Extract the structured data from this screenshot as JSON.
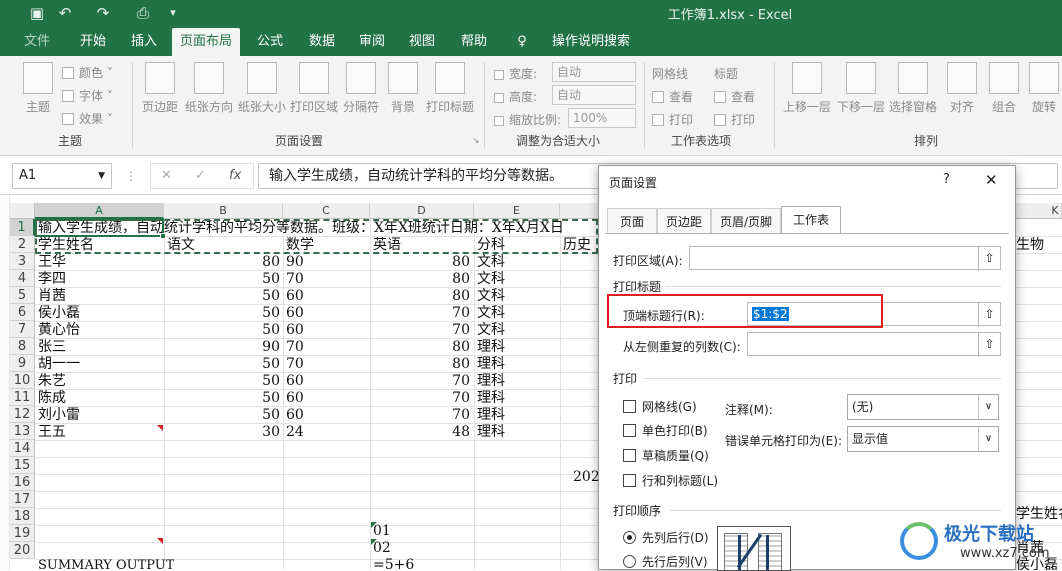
{
  "app": {
    "title": "工作簿1.xlsx  -  Excel"
  },
  "menu_tabs": [
    "文件",
    "开始",
    "插入",
    "页面布局",
    "公式",
    "数据",
    "审阅",
    "视图",
    "帮助",
    "操作说明搜索"
  ],
  "ribbon": {
    "theme_group": {
      "label": "主题",
      "themes": "主题",
      "colors": "颜色",
      "fonts": "字体",
      "effects": "效果"
    },
    "page_setup_group": {
      "label": "页面设置",
      "margins": "页边距",
      "orientation": "纸张方向",
      "size": "纸张大小",
      "print_area": "打印区域",
      "breaks": "分隔符",
      "background": "背景",
      "print_titles": "打印标题"
    },
    "scale_group": {
      "label": "调整为合适大小",
      "width_label": "宽度:",
      "width_value": "自动",
      "height_label": "高度:",
      "height_value": "自动",
      "scale_label": "缩放比例:",
      "scale_value": "100%"
    },
    "sheet_options_group": {
      "label": "工作表选项",
      "gridlines": "网格线",
      "headings": "标题",
      "view": "查看",
      "print": "打印"
    },
    "arrange_group": {
      "label": "排列",
      "bring_forward": "上移一层",
      "send_backward": "下移一层",
      "selection_pane": "选择窗格",
      "align": "对齐",
      "group": "组合",
      "rotate": "旋转"
    }
  },
  "formula_bar": {
    "name_box": "A1",
    "fx": "fx",
    "content": "输入学生成绩，自动统计学科的平均分等数据。"
  },
  "grid": {
    "columns": [
      "A",
      "B",
      "C",
      "D",
      "E",
      "K"
    ],
    "rows": [
      "1",
      "2",
      "3",
      "4",
      "5",
      "6",
      "7",
      "8",
      "9",
      "10",
      "11",
      "12",
      "13",
      "14",
      "15",
      "16",
      "17",
      "18",
      "19",
      "20"
    ],
    "row1": "输入学生成绩，自动统计学科的平均分等数据。班级：X年X班统计日期：X年X月X日",
    "headers": [
      "学生姓名",
      "语文",
      "数学",
      "英语",
      "分科",
      "历史"
    ],
    "students": [
      {
        "name": "王华",
        "chinese": "80",
        "math": "90",
        "english": "80",
        "track": "文科"
      },
      {
        "name": "李四",
        "chinese": "50",
        "math": "70",
        "english": "80",
        "track": "文科"
      },
      {
        "name": "肖茜",
        "chinese": "50",
        "math": "60",
        "english": "80",
        "track": "文科"
      },
      {
        "name": "侯小磊",
        "chinese": "50",
        "math": "60",
        "english": "70",
        "track": "文科"
      },
      {
        "name": "黄心怡",
        "chinese": "50",
        "math": "60",
        "english": "70",
        "track": "文科"
      },
      {
        "name": "张三",
        "chinese": "90",
        "math": "70",
        "english": "80",
        "track": "理科"
      },
      {
        "name": "胡一一",
        "chinese": "50",
        "math": "70",
        "english": "80",
        "track": "理科"
      },
      {
        "name": "朱艺",
        "chinese": "50",
        "math": "60",
        "english": "70",
        "track": "理科"
      },
      {
        "name": "陈成",
        "chinese": "50",
        "math": "60",
        "english": "70",
        "track": "理科"
      },
      {
        "name": "刘小雷",
        "chinese": "50",
        "math": "60",
        "english": "70",
        "track": "理科"
      },
      {
        "name": "王五",
        "chinese": "30",
        "math": "24",
        "english": "48",
        "track": "理科"
      }
    ],
    "f15": "202",
    "d18": "01",
    "d19": "02",
    "a20": "SUMMARY OUTPUT",
    "d20": "=5+6",
    "right_cells": [
      "生物",
      "学生姓名",
      "肖茜",
      "侯小磊"
    ]
  },
  "dialog": {
    "title": "页面设置",
    "help": "?",
    "close": "✕",
    "tabs": [
      "页面",
      "页边距",
      "页眉/页脚",
      "工作表"
    ],
    "print_area_label": "打印区域(A):",
    "print_titles_section": "打印标题",
    "rows_repeat_label": "顶端标题行(R):",
    "rows_repeat_value": "$1:$2",
    "cols_repeat_label": "从左侧重复的列数(C):",
    "print_section": "打印",
    "gridlines": "网格线(G)",
    "black_white": "单色打印(B)",
    "draft": "草稿质量(Q)",
    "row_col_headings": "行和列标题(L)",
    "comments_label": "注释(M):",
    "comments_value": "(无)",
    "errors_label": "错误单元格打印为(E):",
    "errors_value": "显示值",
    "order_section": "打印顺序",
    "down_then_over": "先列后行(D)",
    "over_then_down": "先行后列(V)"
  },
  "watermark": {
    "text": "极光下载站",
    "url": "www.xz7.com"
  },
  "colors": {
    "excel_green": "#217346",
    "highlight_red": "#e02020"
  }
}
